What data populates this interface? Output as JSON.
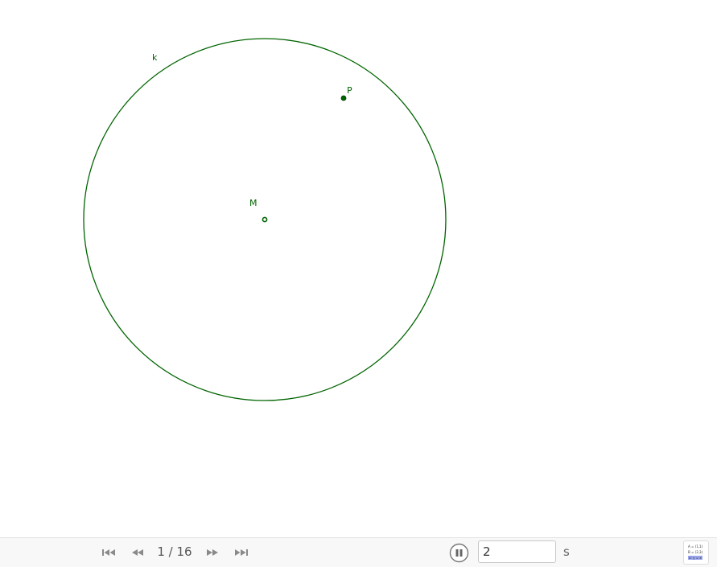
{
  "construction": {
    "circle": {
      "label": "k",
      "color": "#006400"
    },
    "point_m": {
      "label": "M",
      "color": "#006400"
    },
    "point_p": {
      "label": "P",
      "color": "#006400"
    }
  },
  "navigation": {
    "step_text": "1 / 16",
    "first_icon": "skip-to-start-icon",
    "prev_icon": "step-back-icon",
    "next_icon": "step-forward-icon",
    "last_icon": "skip-to-end-icon",
    "pause_icon": "pause-icon",
    "speed_value": "2",
    "speed_unit": "s",
    "algebra_icon": "algebra-view-icon",
    "algebra_lines": [
      "A = (1,1)",
      "B = (2,3)",
      "a: y = x"
    ]
  },
  "colors": {
    "construction": "#006400",
    "nav_icon": "#8a8a8a",
    "nav_background": "#f8f8f8"
  }
}
